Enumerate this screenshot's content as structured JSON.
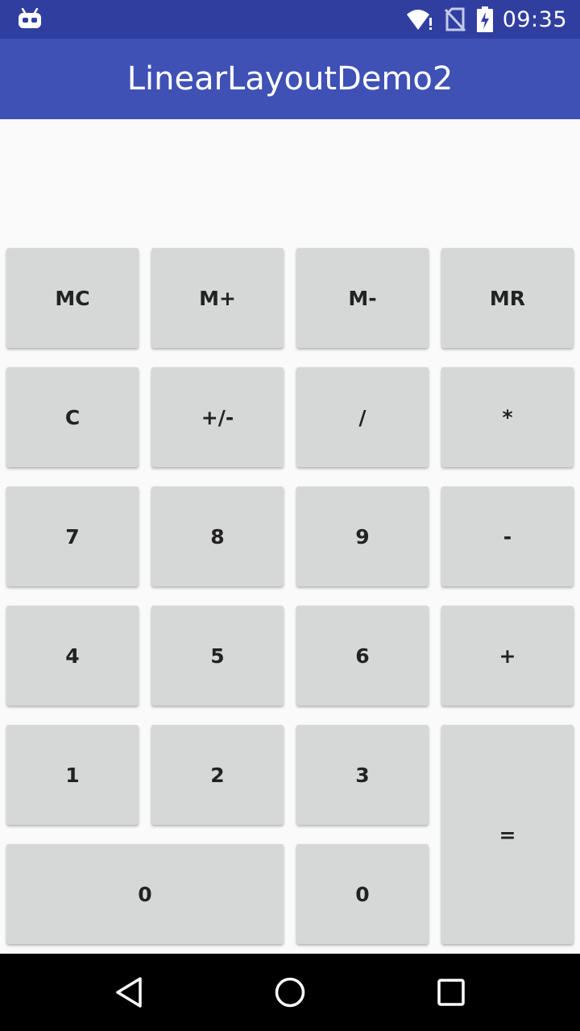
{
  "status_bar": {
    "time": "09:35",
    "icons": [
      "android-debug-icon",
      "wifi-alert-icon",
      "no-sim-icon",
      "battery-charging-icon"
    ]
  },
  "app_bar": {
    "title": "LinearLayoutDemo2",
    "colors": {
      "primary": "#3F51B5",
      "primary_dark": "#303F9F"
    }
  },
  "keypad": {
    "row1": [
      "MC",
      "M+",
      "M-",
      "MR"
    ],
    "row2": [
      "C",
      "+/-",
      "/",
      "*"
    ],
    "row3": [
      "7",
      "8",
      "9",
      "-"
    ],
    "row4": [
      "4",
      "5",
      "6",
      "+"
    ],
    "row5": [
      "1",
      "2",
      "3"
    ],
    "row6": [
      "0",
      "0"
    ],
    "equals": "="
  },
  "nav_bar": {
    "icons": [
      "back-icon",
      "home-icon",
      "recents-icon"
    ]
  }
}
